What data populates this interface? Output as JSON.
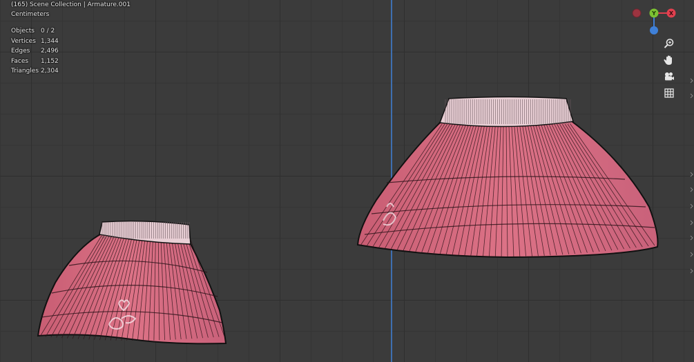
{
  "header": {
    "title": "(165) Scene Collection | Armature.001",
    "units": "Centimeters"
  },
  "stats": [
    {
      "label": "Objects",
      "value": "0 / 2"
    },
    {
      "label": "Vertices",
      "value": "1,344"
    },
    {
      "label": "Edges",
      "value": "2,496"
    },
    {
      "label": "Faces",
      "value": "1,152"
    },
    {
      "label": "Triangles",
      "value": "2,304"
    }
  ],
  "gizmo": {
    "x_axis": "X",
    "y_axis": "Y",
    "colors": {
      "x": "#e2404f",
      "y": "#7cc232",
      "z": "#3f80d8",
      "x_neg": "#9c3440"
    }
  },
  "tools": [
    "zoom-icon",
    "hand-pan-icon",
    "camera-icon",
    "grid-icon"
  ],
  "colors": {
    "skirt": "#d86a80",
    "waistband": "#e8cbd2",
    "wire": "#111111",
    "grid_line": "#2f2f2f"
  }
}
